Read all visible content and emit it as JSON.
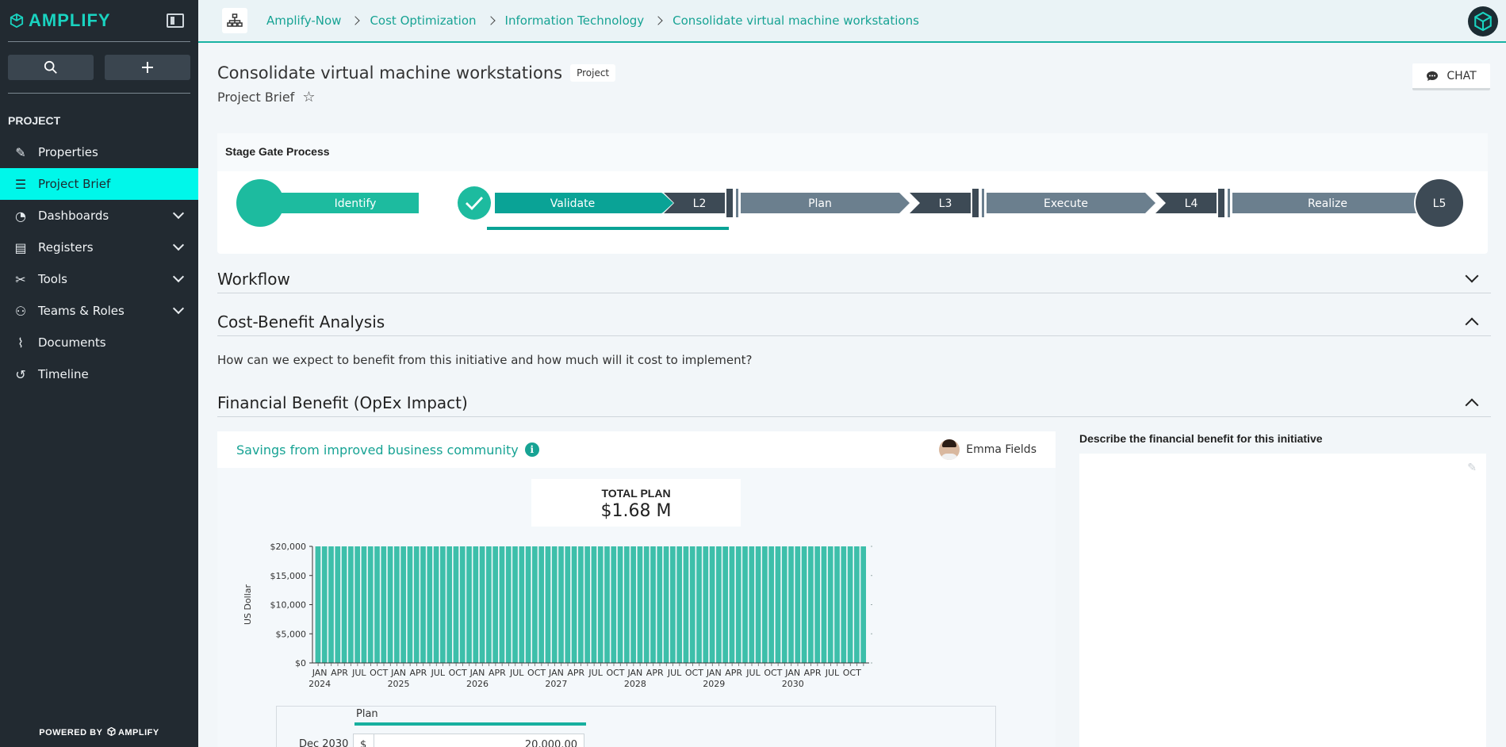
{
  "sidebar": {
    "logo_text": "AMPLIFY",
    "section_label": "PROJECT",
    "items": [
      {
        "label": "Properties",
        "icon": "pencil-icon",
        "expandable": false
      },
      {
        "label": "Project Brief",
        "icon": "list-icon",
        "expandable": false,
        "active": true
      },
      {
        "label": "Dashboards",
        "icon": "dashboard-icon",
        "expandable": true
      },
      {
        "label": "Registers",
        "icon": "register-icon",
        "expandable": true
      },
      {
        "label": "Tools",
        "icon": "tools-icon",
        "expandable": true
      },
      {
        "label": "Teams & Roles",
        "icon": "team-icon",
        "expandable": true
      },
      {
        "label": "Documents",
        "icon": "paperclip-icon",
        "expandable": false
      },
      {
        "label": "Timeline",
        "icon": "history-icon",
        "expandable": false
      }
    ],
    "powered_by": "POWERED BY",
    "powered_brand": "AMPLIFY"
  },
  "breadcrumb": [
    "Amplify-Now",
    "Cost Optimization",
    "Information Technology",
    "Consolidate virtual machine workstations"
  ],
  "page": {
    "title": "Consolidate virtual machine workstations",
    "badge": "Project",
    "subtitle": "Project Brief",
    "chat_label": "CHAT"
  },
  "stage_gate": {
    "title": "Stage Gate Process",
    "stages": [
      "Identify",
      "Validate",
      "Plan",
      "Execute",
      "Realize"
    ],
    "gates": [
      "L2",
      "L3",
      "L4",
      "L5"
    ],
    "current_stage": "Validate",
    "completed": [
      "Identify"
    ]
  },
  "sections": {
    "workflow": "Workflow",
    "cost_benefit": "Cost-Benefit Analysis",
    "cost_benefit_question": "How can we expect to benefit from this initiative and how much will it cost to implement?",
    "financial_benefit": "Financial Benefit (OpEx Impact)"
  },
  "benefit": {
    "title": "Savings from improved business community",
    "owner": "Emma Fields",
    "total_label": "TOTAL PLAN",
    "total_value": "$1.68 M",
    "describe_label": "Describe the financial benefit for this initiative",
    "plan_tab": "Plan",
    "plan_month": "Dec 2030",
    "plan_currency": "$",
    "plan_value": "20,000.00"
  },
  "colors": {
    "accent": "#17a394",
    "bar": "#3dbfaa",
    "sidebar": "#222a31",
    "active": "#00f7ea",
    "gate_dark": "#3d4a55",
    "stage_gray": "#6b7f8e"
  },
  "chart_data": {
    "type": "bar",
    "ylabel": "US Dollar",
    "ylim": [
      0,
      20000
    ],
    "yticks": [
      "$0",
      "$5,000",
      "$10,000",
      "$15,000",
      "$20,000"
    ],
    "ytick_values": [
      0,
      5000,
      10000,
      15000,
      20000
    ],
    "month_labels": [
      "JAN",
      "APR",
      "JUL",
      "OCT"
    ],
    "years": [
      "2024",
      "2025",
      "2026",
      "2027",
      "2028",
      "2029",
      "2030"
    ],
    "series": [
      {
        "values": [
          20000,
          20000,
          20000,
          20000,
          20000,
          20000,
          20000,
          20000,
          20000,
          20000,
          20000,
          20000,
          20000,
          20000,
          20000,
          20000,
          20000,
          20000,
          20000,
          20000,
          20000,
          20000,
          20000,
          20000,
          20000,
          20000,
          20000,
          20000,
          20000,
          20000,
          20000,
          20000,
          20000,
          20000,
          20000,
          20000,
          20000,
          20000,
          20000,
          20000,
          20000,
          20000,
          20000,
          20000,
          20000,
          20000,
          20000,
          20000,
          20000,
          20000,
          20000,
          20000,
          20000,
          20000,
          20000,
          20000,
          20000,
          20000,
          20000,
          20000,
          20000,
          20000,
          20000,
          20000,
          20000,
          20000,
          20000,
          20000,
          20000,
          20000,
          20000,
          20000,
          20000,
          20000,
          20000,
          20000,
          20000,
          20000,
          20000,
          20000,
          20000,
          20000,
          20000,
          20000
        ]
      }
    ]
  }
}
